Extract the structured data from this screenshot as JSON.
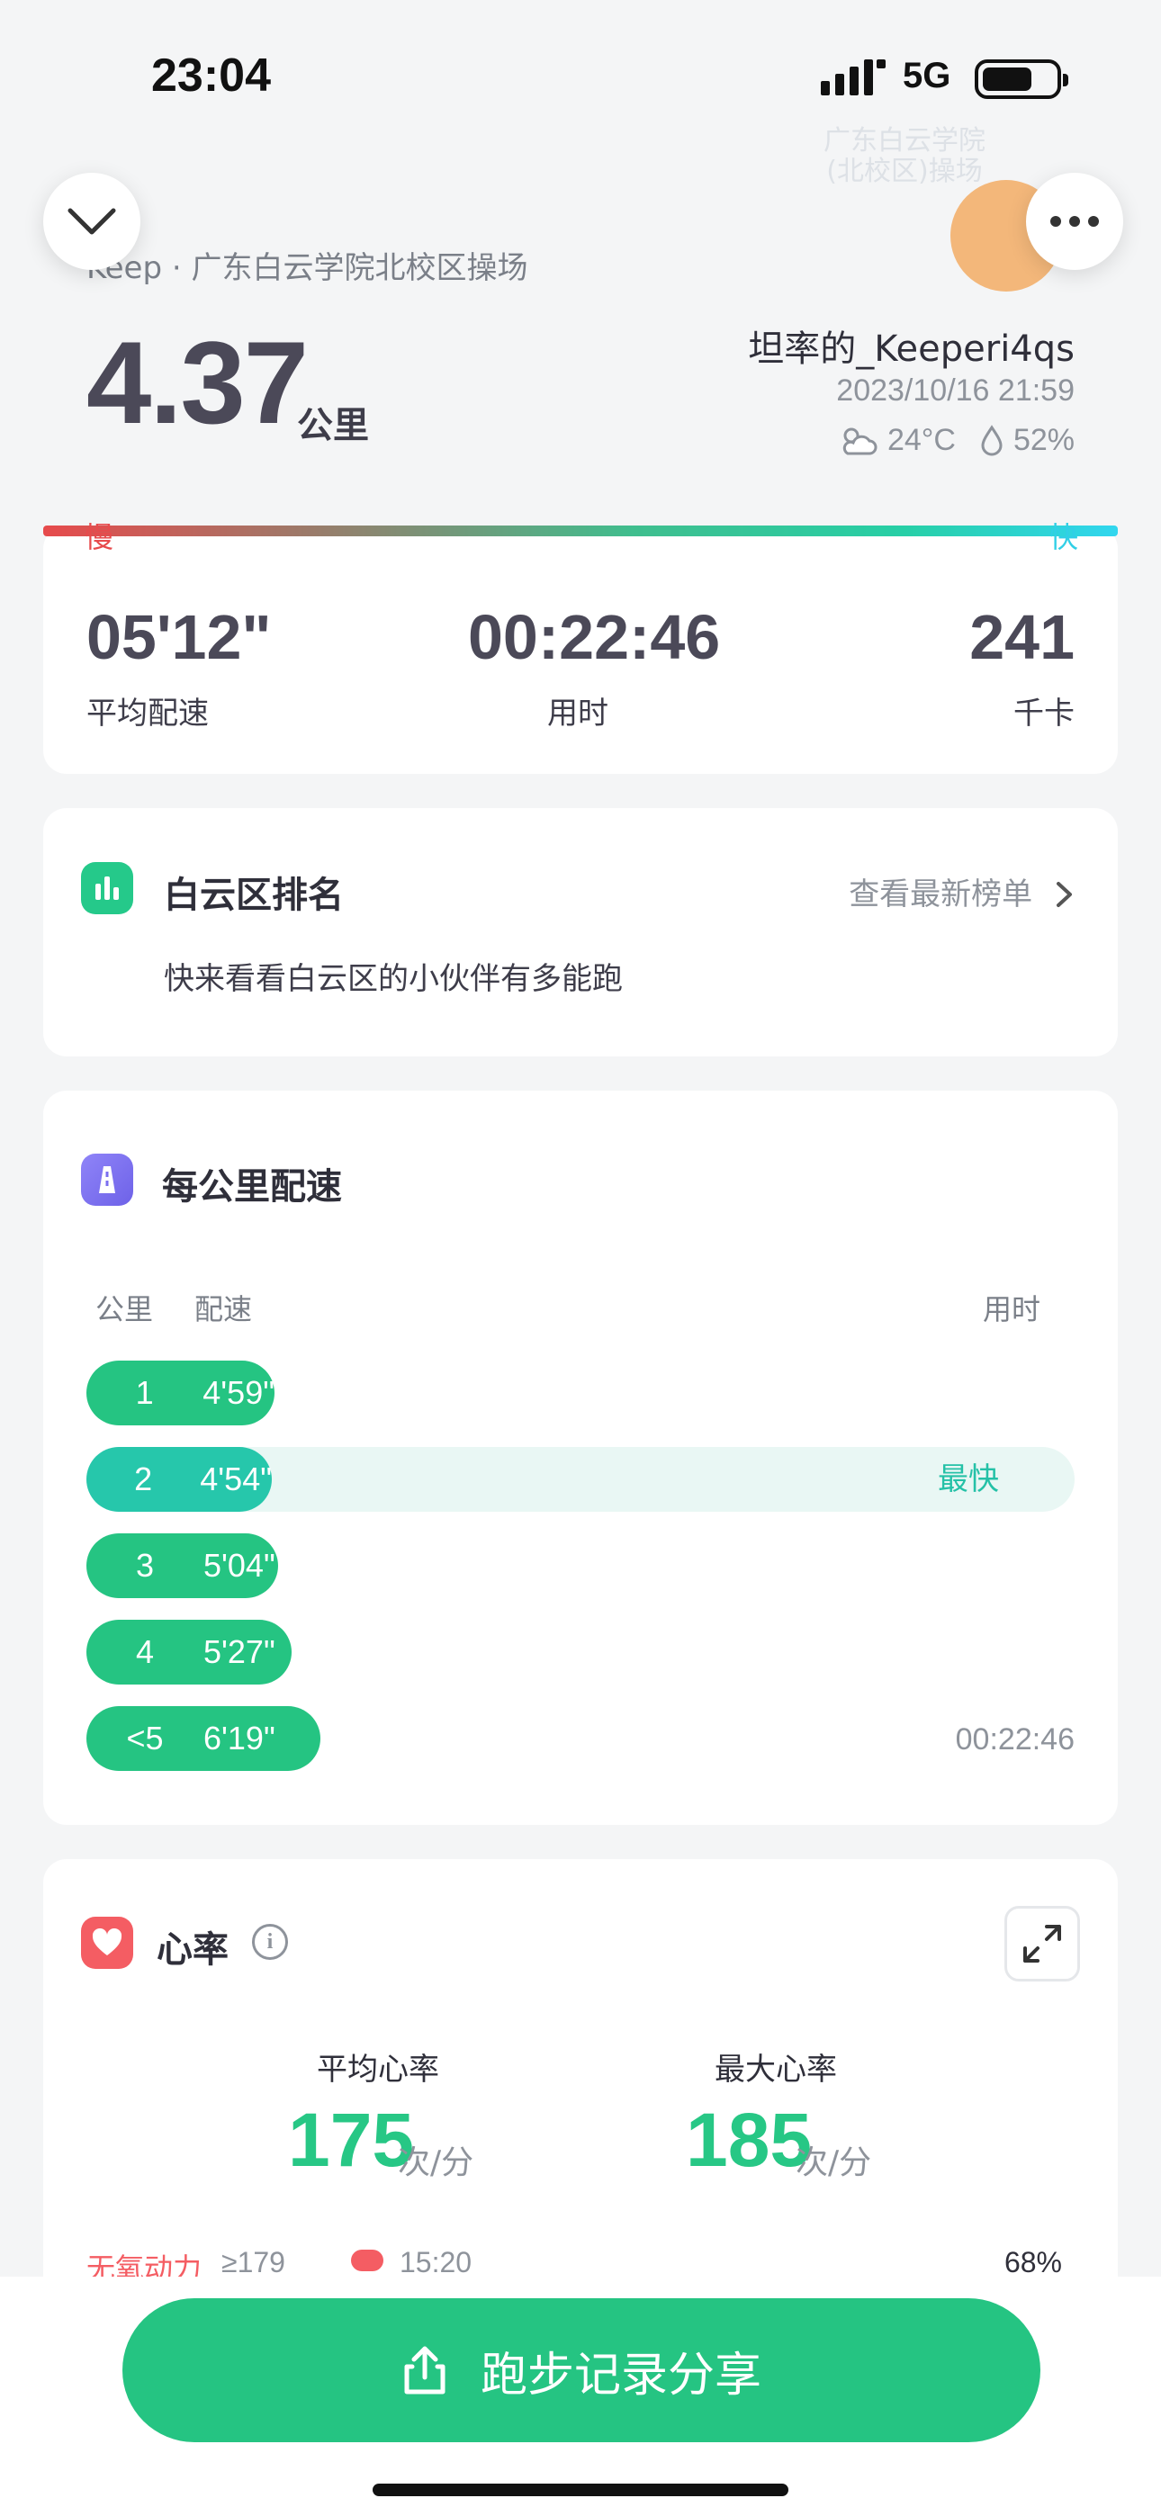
{
  "status_bar": {
    "time": "23:04",
    "network": "5G"
  },
  "header": {
    "watermark": "广东白云学院\n(北校区)操场",
    "location": "Keep · 广东白云学院北校区操场",
    "distance": "4.37",
    "distance_unit": "公里",
    "username": "坦率的_Keeperi4qs",
    "datetime": "2023/10/16 21:59",
    "temperature": "24°C",
    "humidity": "52%"
  },
  "pace_gradient": {
    "slow": "慢",
    "fast": "快"
  },
  "summary": {
    "avg_pace": {
      "value": "05'12\"",
      "label": "平均配速"
    },
    "duration": {
      "value": "00:22:46",
      "label": "用时"
    },
    "calories": {
      "value": "241",
      "label": "千卡"
    }
  },
  "ranking": {
    "title": "白云区排名",
    "link": "查看最新榜单",
    "description": "快来看看白云区的小伙伴有多能跑"
  },
  "pace_per_km": {
    "title": "每公里配速",
    "col_km": "公里",
    "col_pace": "配速",
    "col_time": "用时",
    "rows": [
      {
        "km": "1",
        "pace": "4'59\"",
        "fraction": 0.19
      },
      {
        "km": "2",
        "pace": "4'54\"",
        "fraction": 0.188,
        "tag": "最快"
      },
      {
        "km": "3",
        "pace": "5'04\"",
        "fraction": 0.194
      },
      {
        "km": "4",
        "pace": "5'27\"",
        "fraction": 0.208
      },
      {
        "km": "<5",
        "pace": "6'19\"",
        "fraction": 0.237,
        "time": "00:22:46"
      }
    ]
  },
  "heart_rate": {
    "title": "心率",
    "avg_label": "平均心率",
    "avg_value": "175",
    "max_label": "最大心率",
    "max_value": "185",
    "unit": "次/分",
    "zone": {
      "name": "无氧动力",
      "threshold": "≥179",
      "time": "15:20",
      "percent": "68%"
    }
  },
  "share_button": "跑步记录分享",
  "colors": {
    "accent": "#25c482",
    "fastest": "#25c1a7",
    "heart": "#f45d63",
    "slow": "#e74a4c",
    "fast": "#31d6ef"
  }
}
